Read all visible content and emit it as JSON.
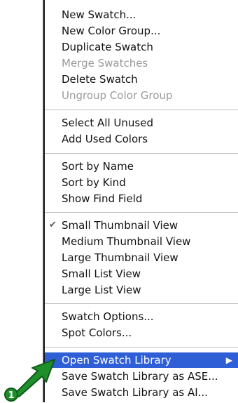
{
  "menu": {
    "items": [
      {
        "label": "New Swatch..."
      },
      {
        "label": "New Color Group..."
      },
      {
        "label": "Duplicate Swatch"
      },
      {
        "label": "Merge Swatches",
        "disabled": true
      },
      {
        "label": "Delete Swatch"
      },
      {
        "label": "Ungroup Color Group",
        "disabled": true
      },
      {
        "label": "Select All Unused"
      },
      {
        "label": "Add Used Colors"
      },
      {
        "label": "Sort by Name"
      },
      {
        "label": "Sort by Kind"
      },
      {
        "label": "Show Find Field"
      },
      {
        "label": "Small Thumbnail View",
        "checked": true
      },
      {
        "label": "Medium Thumbnail View"
      },
      {
        "label": "Large Thumbnail View"
      },
      {
        "label": "Small List View"
      },
      {
        "label": "Large List View"
      },
      {
        "label": "Swatch Options..."
      },
      {
        "label": "Spot Colors..."
      },
      {
        "label": "Open Swatch Library",
        "highlighted": true,
        "submenu": true
      },
      {
        "label": "Save Swatch Library as ASE..."
      },
      {
        "label": "Save Swatch Library as AI..."
      }
    ],
    "check_glyph": "✔",
    "submenu_glyph": "▶"
  },
  "callout": {
    "number": "1",
    "color": "#1f8f2c"
  },
  "colors": {
    "highlight": "#2f5fd6",
    "disabled_text": "#9a9a9a"
  }
}
